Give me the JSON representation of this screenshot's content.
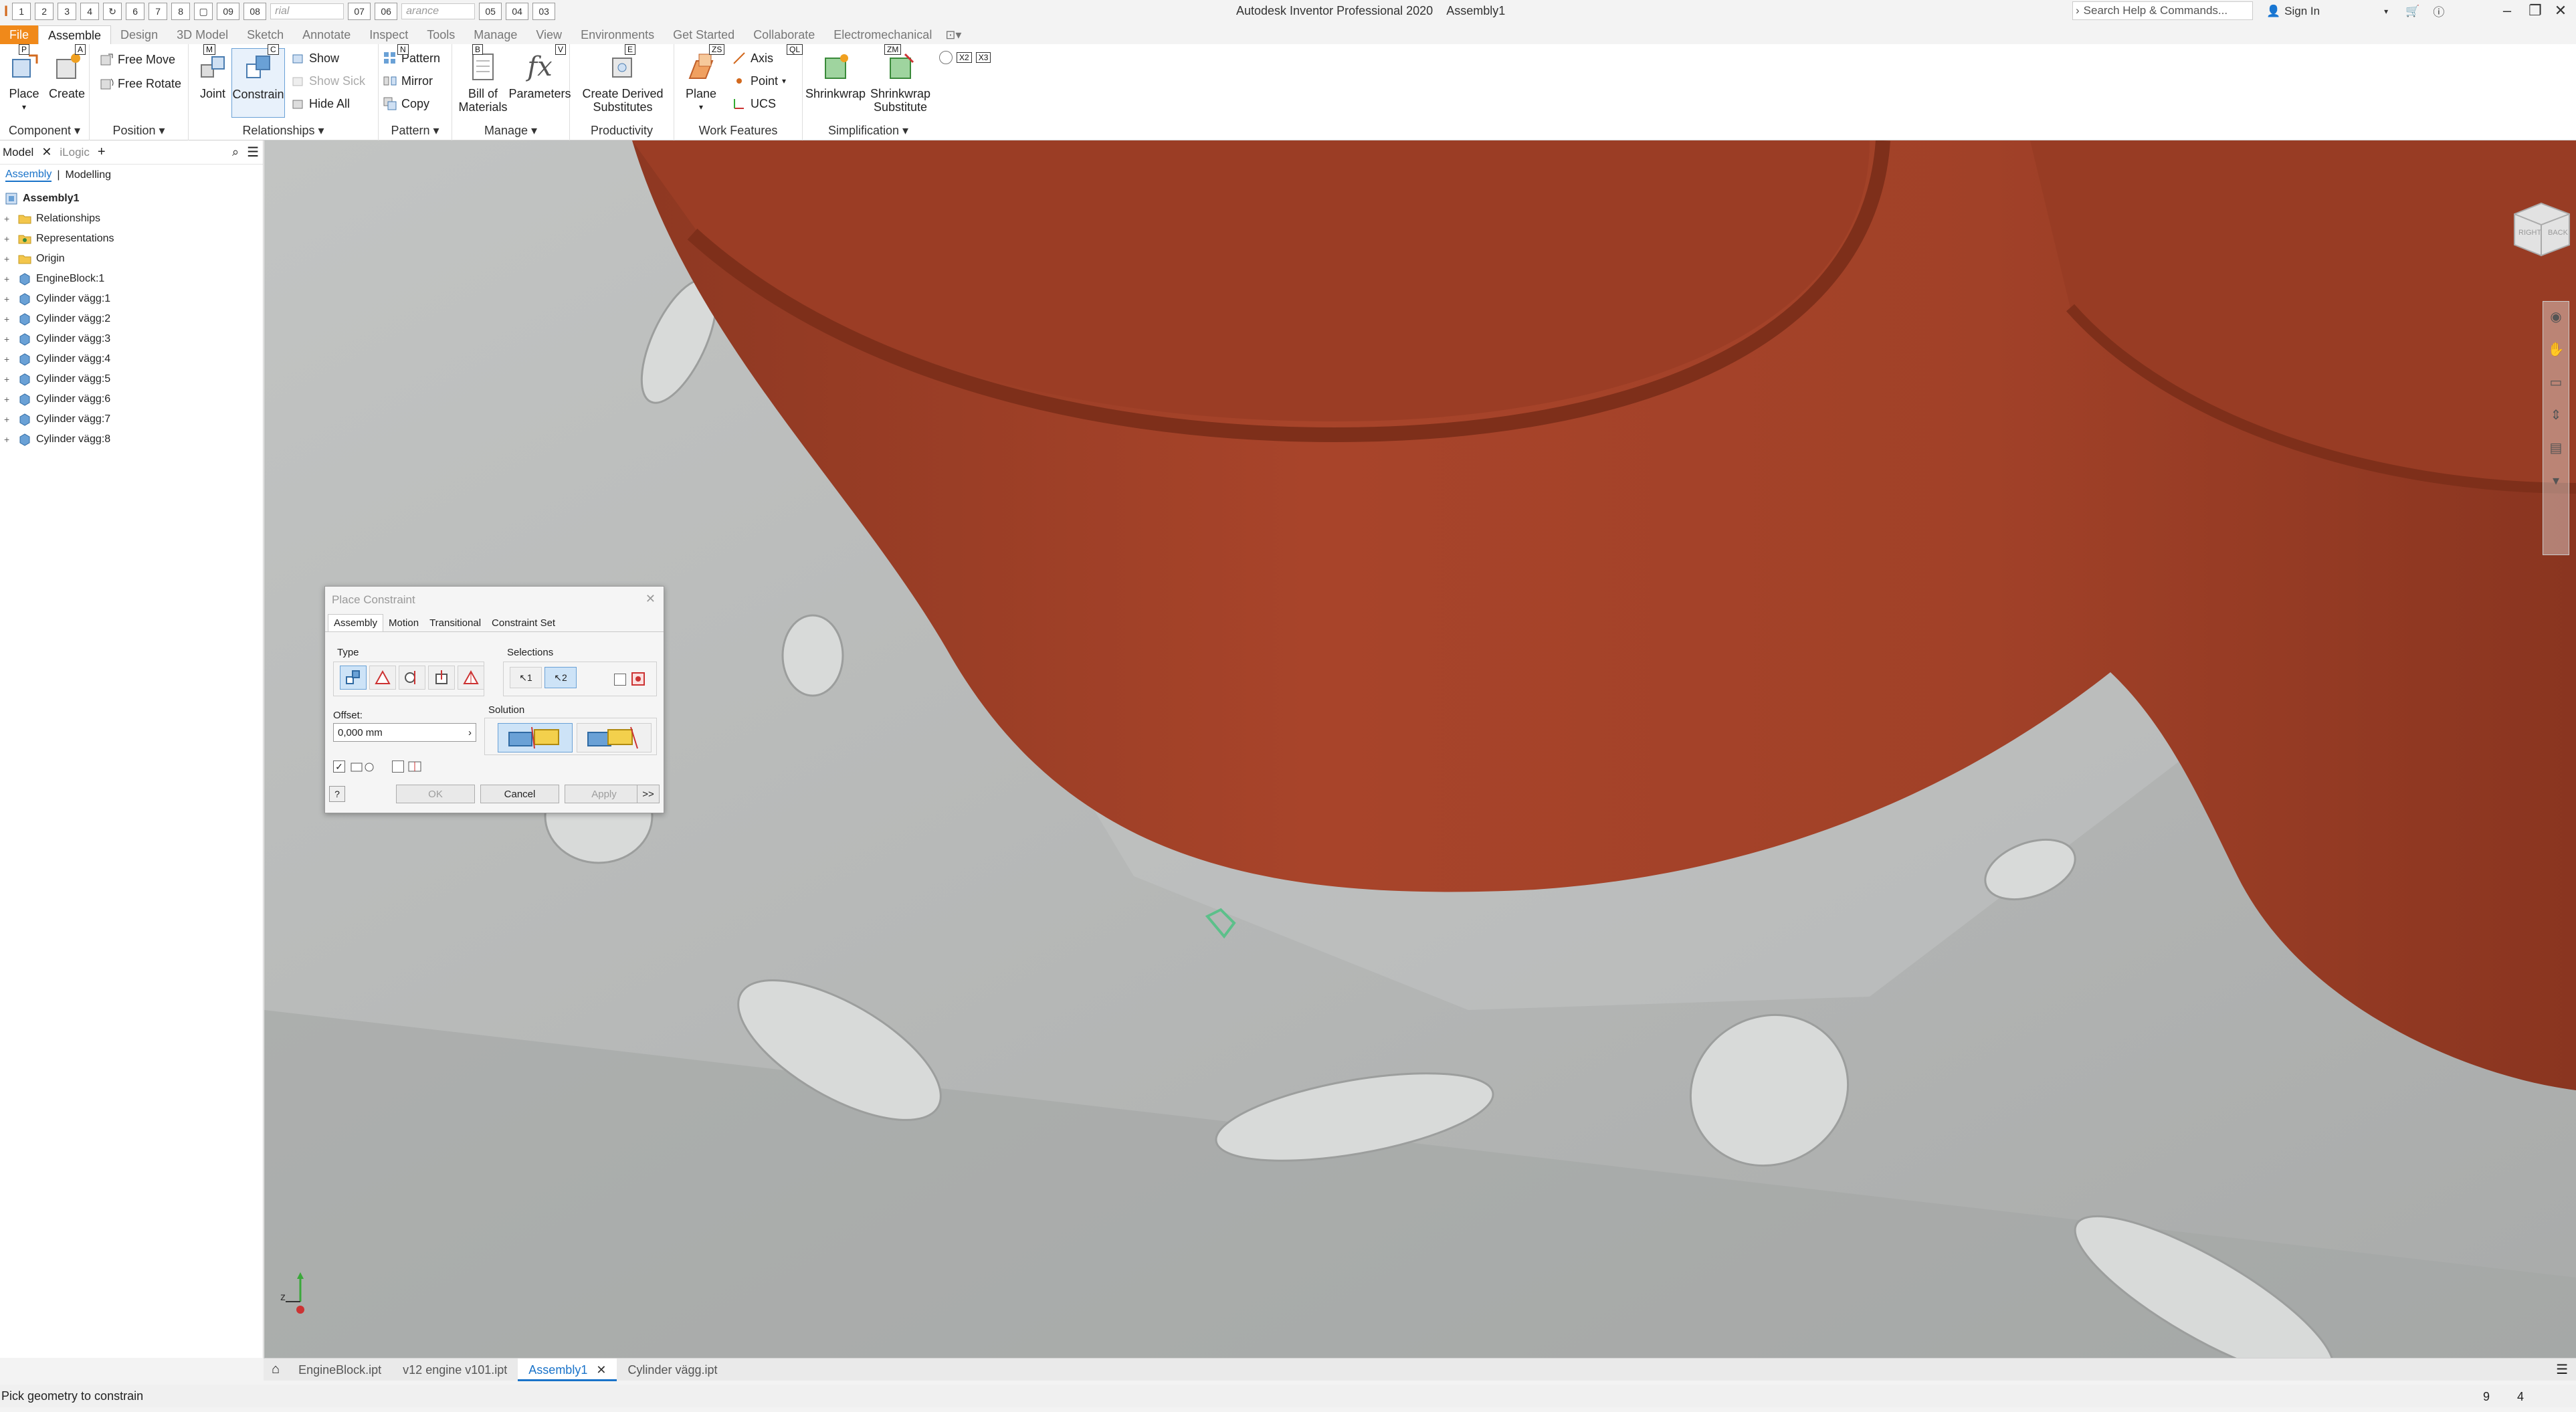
{
  "titlebar": {
    "qat_numbers": [
      "1",
      "2",
      "3",
      "4",
      "6",
      "7",
      "8",
      "09",
      "08",
      "07",
      "06",
      "05",
      "04",
      "03"
    ],
    "material_placeholder": "rial",
    "appearance_placeholder": "arance",
    "app_title": "Autodesk Inventor Professional 2020",
    "doc_title": "Assembly1",
    "search_placeholder": "Search Help & Commands...",
    "signin": "Sign In"
  },
  "ribbon_tabs": [
    {
      "label": "File",
      "key": "F"
    },
    {
      "label": "Assemble",
      "key": ""
    },
    {
      "label": "Design",
      "key": ""
    },
    {
      "label": "3D Model",
      "key": ""
    },
    {
      "label": "Sketch",
      "key": ""
    },
    {
      "label": "Annotate",
      "key": ""
    },
    {
      "label": "Inspect",
      "key": ""
    },
    {
      "label": "Tools",
      "key": ""
    },
    {
      "label": "Manage",
      "key": ""
    },
    {
      "label": "View",
      "key": ""
    },
    {
      "label": "Environments",
      "key": ""
    },
    {
      "label": "Get Started",
      "key": ""
    },
    {
      "label": "Collaborate",
      "key": ""
    },
    {
      "label": "Electromechanical",
      "key": ""
    }
  ],
  "ribbon": {
    "component": {
      "label": "Component",
      "place": "Place",
      "create": "Create",
      "keys": [
        "P",
        "A"
      ]
    },
    "position": {
      "label": "Position",
      "free_move": "Free Move",
      "free_rotate": "Free Rotate"
    },
    "relationships": {
      "label": "Relationships",
      "joint": "Joint",
      "constrain": "Constrain",
      "show": "Show",
      "show_sick": "Show Sick",
      "hide_all": "Hide All",
      "keys": [
        "M",
        "C"
      ]
    },
    "pattern": {
      "label": "Pattern",
      "pattern": "Pattern",
      "mirror": "Mirror",
      "copy": "Copy",
      "key": "N"
    },
    "manage": {
      "label": "Manage",
      "bom_line1": "Bill of",
      "bom_line2": "Materials",
      "parameters": "Parameters",
      "keys": [
        "B",
        "V"
      ]
    },
    "productivity": {
      "label": "Productivity",
      "line1": "Create Derived",
      "line2": "Substitutes",
      "key": "E"
    },
    "work_features": {
      "label": "Work Features",
      "plane": "Plane",
      "axis": "Axis",
      "point": "Point",
      "ucs": "UCS",
      "keys": [
        "ZS",
        "QL"
      ]
    },
    "simplification": {
      "label": "Simplification",
      "shrinkwrap": "Shrinkwrap",
      "sub_line1": "Shrinkwrap",
      "sub_line2": "Substitute",
      "key": "ZM"
    },
    "extra_keys": [
      "X2",
      "X3"
    ]
  },
  "browser": {
    "tab_model": "Model",
    "tab_ilogic": "iLogic",
    "sub_assembly": "Assembly",
    "sub_modelling": "Modelling",
    "root": "Assembly1",
    "items": [
      "Relationships",
      "Representations",
      "Origin",
      "EngineBlock:1",
      "Cylinder vägg:1",
      "Cylinder vägg:2",
      "Cylinder vägg:3",
      "Cylinder vägg:4",
      "Cylinder vägg:5",
      "Cylinder vägg:6",
      "Cylinder vägg:7",
      "Cylinder vägg:8"
    ]
  },
  "dialog": {
    "title": "Place Constraint",
    "tabs": [
      "Assembly",
      "Motion",
      "Transitional",
      "Constraint Set"
    ],
    "type_label": "Type",
    "selections_label": "Selections",
    "sel1": "1",
    "sel2": "2",
    "offset_label": "Offset:",
    "offset_value": "0,000 mm",
    "solution_label": "Solution",
    "ok": "OK",
    "cancel": "Cancel",
    "apply": "Apply",
    "more": ">>"
  },
  "doc_tabs": [
    "EngineBlock.ipt",
    "v12 engine v101.ipt",
    "Assembly1",
    "Cylinder vägg.ipt"
  ],
  "status": {
    "message": "Pick geometry to constrain",
    "num1": "9",
    "num2": "4"
  },
  "viewcube": {
    "face1": "RIGHT",
    "face2": "BACK"
  },
  "colors": {
    "accent": "#1a73c9",
    "file_tab": "#f0891a",
    "cylinder": "#a8442a",
    "engine_block": "#b4b6b5"
  }
}
